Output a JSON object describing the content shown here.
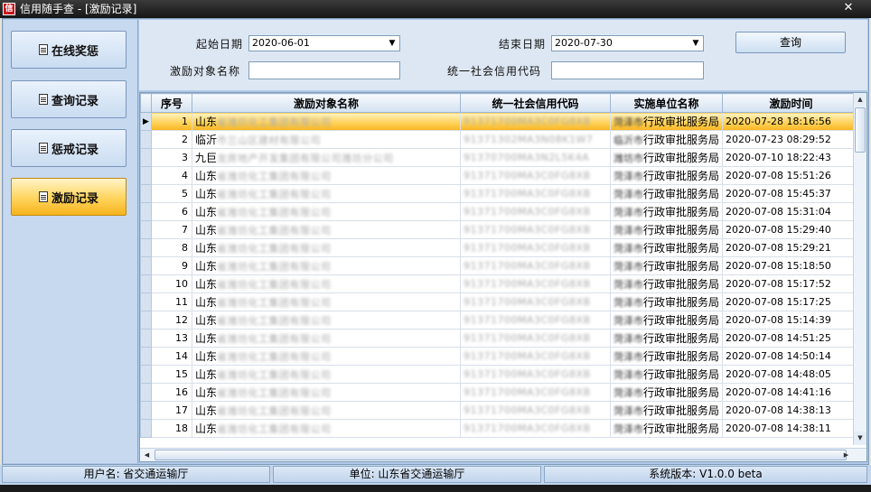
{
  "window": {
    "title": "信用随手查 - [激励记录]",
    "icon_text": "信",
    "close_glyph": "✕"
  },
  "sidebar": {
    "items": [
      {
        "label": "在线奖惩",
        "active": false
      },
      {
        "label": "查询记录",
        "active": false
      },
      {
        "label": "惩戒记录",
        "active": false
      },
      {
        "label": "激励记录",
        "active": true
      }
    ]
  },
  "filters": {
    "start_label": "起始日期",
    "start_value": "2020-06-01",
    "end_label": "结束日期",
    "end_value": "2020-07-30",
    "name_label": "激励对象名称",
    "name_value": "",
    "code_label": "统一社会信用代码",
    "code_value": "",
    "query_label": "查询"
  },
  "grid": {
    "columns": [
      "序号",
      "激励对象名称",
      "统一社会信用代码",
      "实施单位名称",
      "激励时间"
    ],
    "current_row_marker": "▶",
    "rows": [
      {
        "no": "1",
        "name_prefix": "山东",
        "name_masked": "省潍坊化工集团有限公司",
        "code_masked": "91371700MA3C0FG8XB",
        "unit_masked": "菏泽市",
        "unit_suffix": "行政审批服务局",
        "time": "2020-07-28 18:16:56"
      },
      {
        "no": "2",
        "name_prefix": "临沂",
        "name_masked": "市兰山区建材有限公司",
        "code_masked": "91371302MA3N08K1W7",
        "unit_masked": "临沂市",
        "unit_suffix": "行政审批服务局",
        "time": "2020-07-23 08:29:52"
      },
      {
        "no": "3",
        "name_prefix": "九巨",
        "name_masked": "龙房地产开发集团有限公司潍坊分公司",
        "code_masked": "91370700MA3N2L5K4A",
        "unit_masked": "潍坊市",
        "unit_suffix": "行政审批服务局",
        "time": "2020-07-10 18:22:43"
      },
      {
        "no": "4",
        "name_prefix": "山东",
        "name_masked": "省潍坊化工集团有限公司",
        "code_masked": "91371700MA3C0FG8XB",
        "unit_masked": "菏泽市",
        "unit_suffix": "行政审批服务局",
        "time": "2020-07-08 15:51:26"
      },
      {
        "no": "5",
        "name_prefix": "山东",
        "name_masked": "省潍坊化工集团有限公司",
        "code_masked": "91371700MA3C0FG8XB",
        "unit_masked": "菏泽市",
        "unit_suffix": "行政审批服务局",
        "time": "2020-07-08 15:45:37"
      },
      {
        "no": "6",
        "name_prefix": "山东",
        "name_masked": "省潍坊化工集团有限公司",
        "code_masked": "91371700MA3C0FG8XB",
        "unit_masked": "菏泽市",
        "unit_suffix": "行政审批服务局",
        "time": "2020-07-08 15:31:04"
      },
      {
        "no": "7",
        "name_prefix": "山东",
        "name_masked": "省潍坊化工集团有限公司",
        "code_masked": "91371700MA3C0FG8XB",
        "unit_masked": "菏泽市",
        "unit_suffix": "行政审批服务局",
        "time": "2020-07-08 15:29:40"
      },
      {
        "no": "8",
        "name_prefix": "山东",
        "name_masked": "省潍坊化工集团有限公司",
        "code_masked": "91371700MA3C0FG8XB",
        "unit_masked": "菏泽市",
        "unit_suffix": "行政审批服务局",
        "time": "2020-07-08 15:29:21"
      },
      {
        "no": "9",
        "name_prefix": "山东",
        "name_masked": "省潍坊化工集团有限公司",
        "code_masked": "91371700MA3C0FG8XB",
        "unit_masked": "菏泽市",
        "unit_suffix": "行政审批服务局",
        "time": "2020-07-08 15:18:50"
      },
      {
        "no": "10",
        "name_prefix": "山东",
        "name_masked": "省潍坊化工集团有限公司",
        "code_masked": "91371700MA3C0FG8XB",
        "unit_masked": "菏泽市",
        "unit_suffix": "行政审批服务局",
        "time": "2020-07-08 15:17:52"
      },
      {
        "no": "11",
        "name_prefix": "山东",
        "name_masked": "省潍坊化工集团有限公司",
        "code_masked": "91371700MA3C0FG8XB",
        "unit_masked": "菏泽市",
        "unit_suffix": "行政审批服务局",
        "time": "2020-07-08 15:17:25"
      },
      {
        "no": "12",
        "name_prefix": "山东",
        "name_masked": "省潍坊化工集团有限公司",
        "code_masked": "91371700MA3C0FG8XB",
        "unit_masked": "菏泽市",
        "unit_suffix": "行政审批服务局",
        "time": "2020-07-08 15:14:39"
      },
      {
        "no": "13",
        "name_prefix": "山东",
        "name_masked": "省潍坊化工集团有限公司",
        "code_masked": "91371700MA3C0FG8XB",
        "unit_masked": "菏泽市",
        "unit_suffix": "行政审批服务局",
        "time": "2020-07-08 14:51:25"
      },
      {
        "no": "14",
        "name_prefix": "山东",
        "name_masked": "省潍坊化工集团有限公司",
        "code_masked": "91371700MA3C0FG8XB",
        "unit_masked": "菏泽市",
        "unit_suffix": "行政审批服务局",
        "time": "2020-07-08 14:50:14"
      },
      {
        "no": "15",
        "name_prefix": "山东",
        "name_masked": "省潍坊化工集团有限公司",
        "code_masked": "91371700MA3C0FG8XB",
        "unit_masked": "菏泽市",
        "unit_suffix": "行政审批服务局",
        "time": "2020-07-08 14:48:05"
      },
      {
        "no": "16",
        "name_prefix": "山东",
        "name_masked": "省潍坊化工集团有限公司",
        "code_masked": "91371700MA3C0FG8XB",
        "unit_masked": "菏泽市",
        "unit_suffix": "行政审批服务局",
        "time": "2020-07-08 14:41:16"
      },
      {
        "no": "17",
        "name_prefix": "山东",
        "name_masked": "省潍坊化工集团有限公司",
        "code_masked": "91371700MA3C0FG8XB",
        "unit_masked": "菏泽市",
        "unit_suffix": "行政审批服务局",
        "time": "2020-07-08 14:38:13"
      },
      {
        "no": "18",
        "name_prefix": "山东",
        "name_masked": "省潍坊化工集团有限公司",
        "code_masked": "91371700MA3C0FG8XB",
        "unit_masked": "菏泽市",
        "unit_suffix": "行政审批服务局",
        "time": "2020-07-08 14:38:11"
      }
    ]
  },
  "status": {
    "user": "用户名: 省交通运输厅",
    "unit": "单位: 山东省交通运输厅",
    "version": "系统版本: V1.0.0 beta"
  },
  "colors": {
    "frame_blue": "#b0c8e6",
    "selected_gold": "#ffd35c",
    "title_bar": "#151515"
  }
}
